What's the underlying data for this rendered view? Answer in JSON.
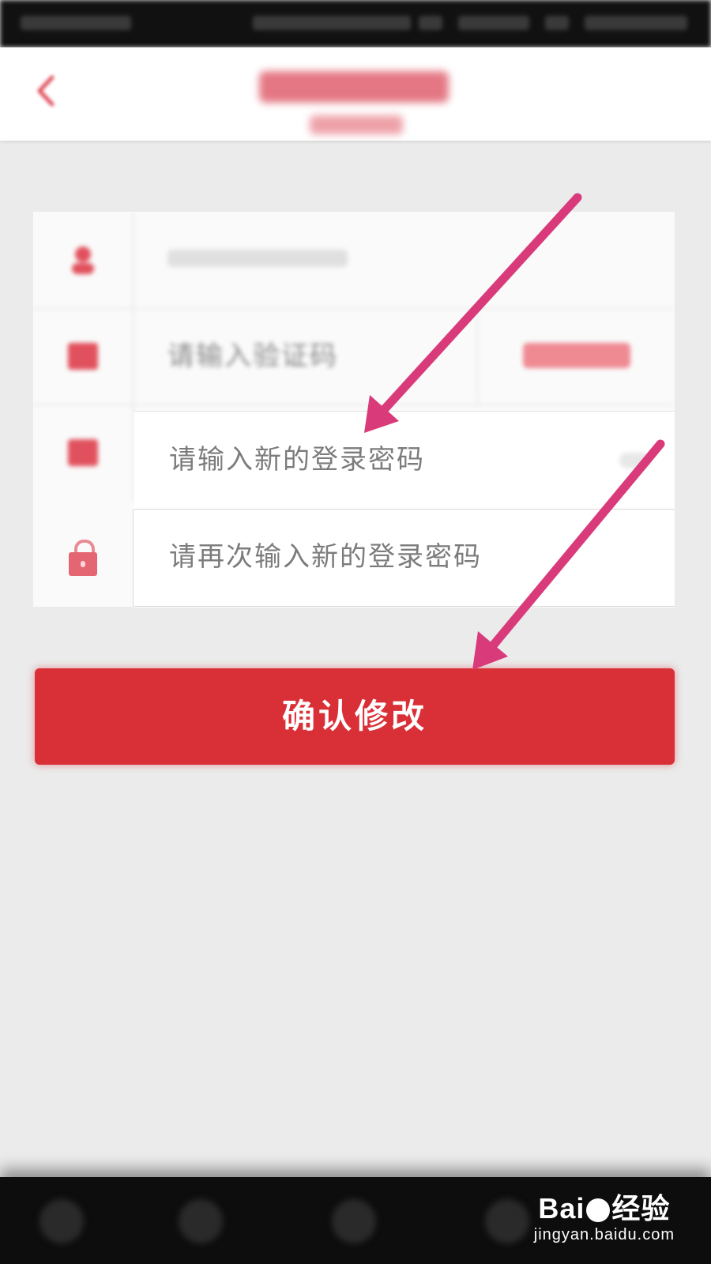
{
  "form": {
    "verify_code_placeholder": "请输入验证码",
    "new_password_placeholder": "请输入新的登录密码",
    "confirm_password_placeholder": "请再次输入新的登录密码"
  },
  "confirm_button": {
    "label": "确认修改"
  },
  "watermark": {
    "logo_prefix": "Bai",
    "logo_suffix": "经验",
    "url": "jingyan.baidu.com"
  },
  "colors": {
    "accent_red": "#d93037",
    "arrow_pink": "#d93a7a",
    "icon_red": "#e1505d"
  },
  "icons": [
    "back-arrow-icon",
    "user-icon",
    "shield-icon",
    "key-icon",
    "lock-icon"
  ]
}
